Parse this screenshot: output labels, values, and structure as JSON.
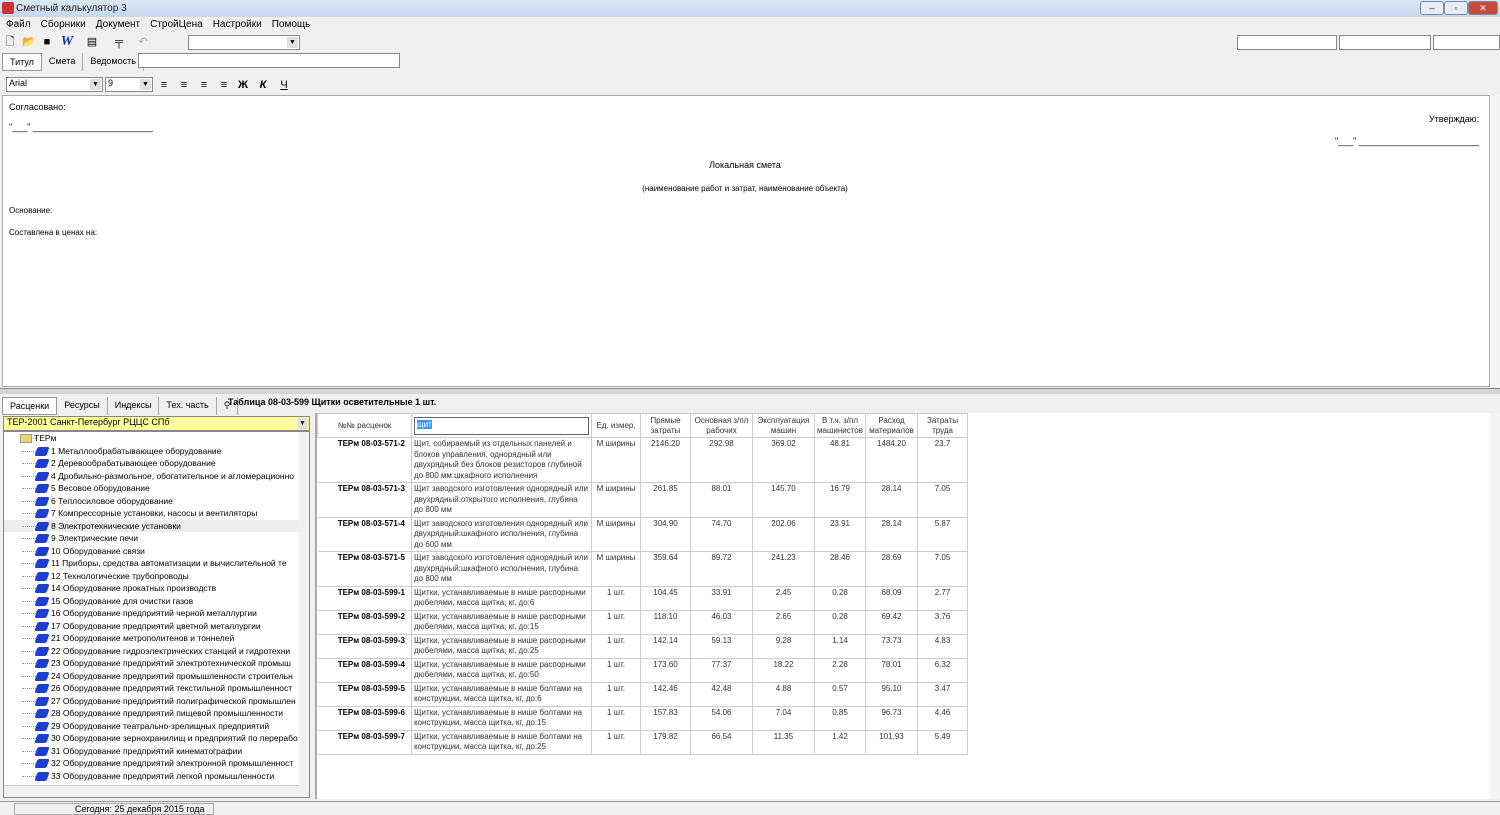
{
  "window": {
    "title": "Сметный калькулятор 3"
  },
  "menu": [
    "Файл",
    "Сборники",
    "Документ",
    "СтройЦена",
    "Настройки",
    "Помощь"
  ],
  "doc_tabs": [
    "Титул",
    "Смета",
    "Ведомость"
  ],
  "format": {
    "font": "Arial",
    "size": "9",
    "bold": "Ж",
    "italic": "К",
    "underline": "Ч"
  },
  "document": {
    "agreed": "Согласовано:",
    "date_line_left": "\"___\" ________________________",
    "approve": "Утверждаю:",
    "date_line_right": "\"___\" ________________________",
    "title": "Локальная смета",
    "subtitle": "(наименование работ и затрат, наименование объекта)",
    "basis": "Основание:",
    "prices": "Составлена в ценах на:"
  },
  "bottom_tabs": [
    "Расценки",
    "Ресурсы",
    "Индексы",
    "Тех. часть"
  ],
  "table_title": "Таблица 08-03-599 Щитки осветительные 1 шт.",
  "base_select": "ТЕР-2001 Санкт-Петербург РЦЦС СПб",
  "tree": {
    "root": "ТЕРм",
    "items": [
      "1 Металлообрабатывающее оборудование",
      "2 Деревообрабатывающее оборудование",
      "4 Дробильно-размольное, обогатительное и агломерационно",
      "5 Весовое оборудование",
      "6 Теплосиловое оборудование",
      "7 Компрессорные установки, насосы и вентиляторы",
      "8 Электротехнические установки",
      "9 Электрические печи",
      "10 Оборудование связи",
      "11 Приборы, средства автоматизации и вычислительной те",
      "12 Технологические трубопроводы",
      "14 Оборудование прокатных производств",
      "15 Оборудование для очистки газов",
      "16 Оборудование предприятий черной металлургии",
      "17 Оборудование предприятий цветной металлургии",
      "21 Оборудование метрополитенов и тоннелей",
      "22 Оборудование гидроэлектрических станций и гидротехни",
      "23 Оборудование предприятий электротехнической промыш",
      "24 Оборудование предприятий промышленности строительн",
      "26 Оборудование предприятий текстильной промышленност",
      "27 Оборудование предприятий полиграфической промышлен",
      "28 Оборудование предприятий пищевой промышленности",
      "29 Оборудование театрально-зрелищных предприятий",
      "30 Оборудование зернохранилищ и предприятий по перерабо",
      "31 Оборудование предприятий кинематографии",
      "32 Оборудование предприятий электронной промышленност",
      "33 Оборудование предприятий легкой промышленности"
    ]
  },
  "grid": {
    "search_value": "щит",
    "headers": [
      "№№ расценок",
      "Ед. измер.",
      "Прямые затраты",
      "Основная з/пл рабочих",
      "Эксплуатация машин",
      "В т.ч. з/пл машинистов",
      "Расход материалов",
      "Затраты труда"
    ],
    "rows": [
      [
        "ТЕРм 08-03-571-2",
        "Щит, собираемый из отдельных панелей и блоков управления, однорядный или двухрядный без блоков резисторов глубиной до 800 мм:шкафного исполнения",
        "М ширины",
        "2146.20",
        "292.98",
        "369.02",
        "48.81",
        "1484.20",
        "23.7"
      ],
      [
        "ТЕРм 08-03-571-3",
        "Щит заводского изготовления однорядный или двухрядный:открытого исполнения, глубина до 800 мм",
        "М ширины",
        "261.85",
        "88.01",
        "145.70",
        "16.79",
        "28.14",
        "7.05"
      ],
      [
        "ТЕРм 08-03-571-4",
        "Щит заводского изготовления однорядный или двухрядный:шкафного исполнения, глубина до 600 мм",
        "М ширины",
        "304.90",
        "74.70",
        "202.06",
        "23.91",
        "28.14",
        "5.87"
      ],
      [
        "ТЕРм 08-03-571-5",
        "Щит заводского изготовления однорядный или двухрядный:шкафного исполнения, глубина до 800 мм",
        "М ширины",
        "359.64",
        "89.72",
        "241.23",
        "28.46",
        "28.69",
        "7.05"
      ],
      [
        "ТЕРм 08-03-599-1",
        "Щитки, устанавливаемые в нише распорными дюбелями, масса щитка, кг, до:6",
        "1 шт.",
        "104.45",
        "33.91",
        "2.45",
        "0.28",
        "68.09",
        "2.77"
      ],
      [
        "ТЕРм 08-03-599-2",
        "Щитки, устанавливаемые в нише распорными дюбелями, масса щитка, кг, до:15",
        "1 шт.",
        "118.10",
        "46.03",
        "2.65",
        "0.28",
        "69.42",
        "3.76"
      ],
      [
        "ТЕРм 08-03-599-3",
        "Щитки, устанавливаемые в нише распорными дюбелями, масса щитка, кг, до:25",
        "1 шт.",
        "142.14",
        "59.13",
        "9.28",
        "1.14",
        "73.73",
        "4.83"
      ],
      [
        "ТЕРм 08-03-599-4",
        "Щитки, устанавливаемые в нише распорными дюбелями, масса щитка, кг, до:50",
        "1 шт.",
        "173.60",
        "77.37",
        "18.22",
        "2.28",
        "78.01",
        "6.32"
      ],
      [
        "ТЕРм 08-03-599-5",
        "Щитки, устанавливаемые в нише болтами на конструкции, масса щитка, кг, до:6",
        "1 шт.",
        "142.46",
        "42.48",
        "4.88",
        "0.57",
        "95.10",
        "3.47"
      ],
      [
        "ТЕРм 08-03-599-6",
        "Щитки, устанавливаемые в нише болтами на конструкции, масса щитка, кг, до:15",
        "1 шт.",
        "157.83",
        "54.06",
        "7.04",
        "0.85",
        "96.73",
        "4.46"
      ],
      [
        "ТЕРм 08-03-599-7",
        "Щитки, устанавливаемые в нише болтами на конструкции, масса щитка, кг, до:25",
        "1 шт.",
        "179.82",
        "66.54",
        "11.35",
        "1.42",
        "101.93",
        "5.49"
      ]
    ]
  },
  "status": {
    "today": "Сегодня: 25 декабря 2015 года"
  }
}
